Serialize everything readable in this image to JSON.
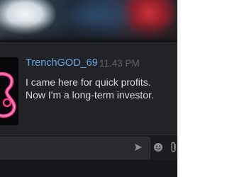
{
  "message": {
    "username": "TrenchGOD_69",
    "timestamp": "11.43 PM",
    "lines": [
      "I came here for quick profits.",
      "Now I'm a long-term investor."
    ]
  },
  "composer": {
    "send_icon": "send-icon",
    "emoji_icon": "emoji-icon",
    "attach_icon": "paperclip-icon"
  },
  "colors": {
    "username": "#6aa5dc",
    "timestamp": "#5f646c",
    "message_text": "#d9dadc",
    "avatar_neon": "#ff3c8c",
    "card_background": "#222327"
  }
}
